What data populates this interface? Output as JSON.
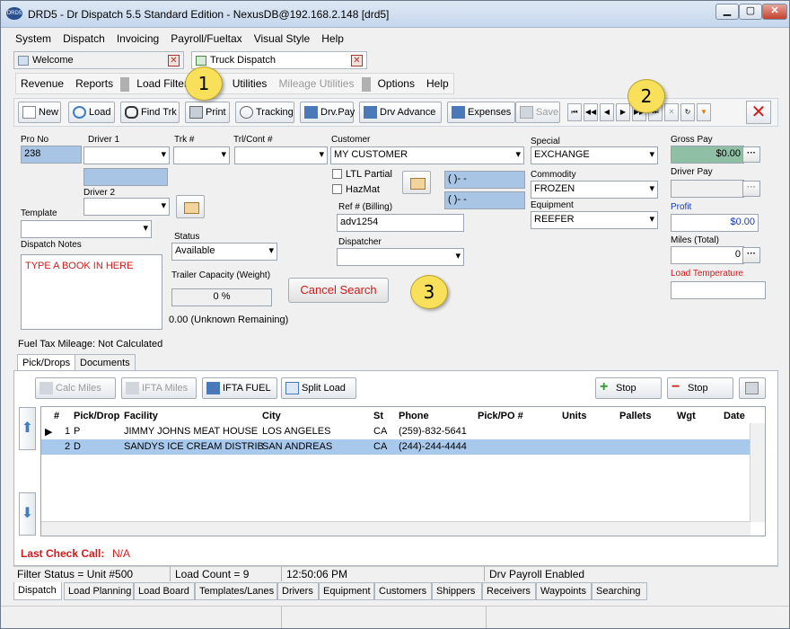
{
  "window": {
    "title": "DRD5 - Dr Dispatch 5.5 Standard Edition - NexusDB@192.168.2.148 [drd5]",
    "app_icon_text": "DRD5"
  },
  "menubar": [
    "System",
    "Dispatch",
    "Invoicing",
    "Payroll/Fueltax",
    "Visual Style",
    "Help"
  ],
  "doc_tabs": [
    {
      "label": "Welcome"
    },
    {
      "label": "Truck Dispatch"
    }
  ],
  "secondary_menu": {
    "items": [
      "Revenue",
      "Reports",
      "Load Filter",
      "Utilities",
      "Mileage Utilities",
      "Options",
      "Help"
    ],
    "partial_label": "D"
  },
  "toolbar": {
    "new": "New",
    "load": "Load",
    "find_trk": "Find Trk",
    "print": "Print",
    "tracking": "Tracking",
    "drv_pay": "Drv.Pay",
    "drv_advance": "Drv Advance",
    "expenses": "Expenses",
    "save": "Save"
  },
  "form": {
    "pro_no_label": "Pro No",
    "pro_no": "238",
    "driver1_label": "Driver 1",
    "driver2_label": "Driver 2",
    "trk_label": "Trk #",
    "trl_label": "Trl/Cont #",
    "customer_label": "Customer",
    "customer": "MY CUSTOMER",
    "ltl_partial": "LTL Partial",
    "hazmat": "HazMat",
    "phone1": "(   )-   -",
    "phone2": "(   )-   -",
    "ref_label": "Ref # (Billing)",
    "ref": "adv1254",
    "dispatcher_label": "Dispatcher",
    "special_label": "Special",
    "special": "EXCHANGE",
    "commodity_label": "Commodity",
    "commodity": "FROZEN",
    "equipment_label": "Equipment",
    "equipment": "REEFER",
    "gross_pay_label": "Gross Pay",
    "gross_pay": "$0.00",
    "driver_pay_label": "Driver Pay",
    "profit_label": "Profit",
    "profit": "$0.00",
    "miles_label": "Miles (Total)",
    "miles": "0",
    "load_temp_label": "Load Temperature",
    "template_label": "Template",
    "dispatch_notes_label": "Dispatch Notes",
    "dispatch_notes": "TYPE A BOOK IN HERE",
    "status_label": "Status",
    "status": "Available",
    "trailer_cap_label": "Trailer Capacity (Weight)",
    "trailer_cap": "0 %",
    "remaining": "0.00 (Unknown Remaining)",
    "cancel_search": "Cancel Search",
    "fuel_tax": "Fuel Tax Mileage:  Not Calculated"
  },
  "callouts": [
    "1",
    "2",
    "3"
  ],
  "sub_tabs": [
    "Pick/Drops",
    "Documents"
  ],
  "stops_toolbar": {
    "calc_miles": "Calc Miles",
    "ifta_miles": "IFTA Miles",
    "ifta_fuel": "IFTA FUEL",
    "split_load": "Split Load",
    "add_stop": "Stop",
    "remove_stop": "Stop"
  },
  "grid": {
    "headers": [
      "#",
      "Pick/Drop",
      "Facility",
      "City",
      "St",
      "Phone",
      "Pick/PO #",
      "Units",
      "Pallets",
      "Wgt",
      "Date"
    ],
    "rows": [
      [
        "1",
        "P",
        "JIMMY JOHNS MEAT HOUSE",
        "LOS ANGELES",
        "CA",
        "(259)-832-5641"
      ],
      [
        "2",
        "D",
        "SANDYS ICE CREAM DISTRIB",
        "SAN ANDREAS",
        "CA",
        "(244)-244-4444"
      ]
    ]
  },
  "last_check_call": {
    "label": "Last Check Call:",
    "value": "N/A"
  },
  "status_bar": {
    "filter": "Filter Status = Unit #500",
    "load_count": "Load Count = 9",
    "time": "12:50:06 PM",
    "payroll": "Drv Payroll Enabled"
  },
  "bottom_tabs": [
    "Dispatch",
    "Load Planning",
    "Load Board",
    "Templates/Lanes",
    "Drivers",
    "Equipment",
    "Customers",
    "Shippers",
    "Receivers",
    "Waypoints",
    "Searching"
  ]
}
